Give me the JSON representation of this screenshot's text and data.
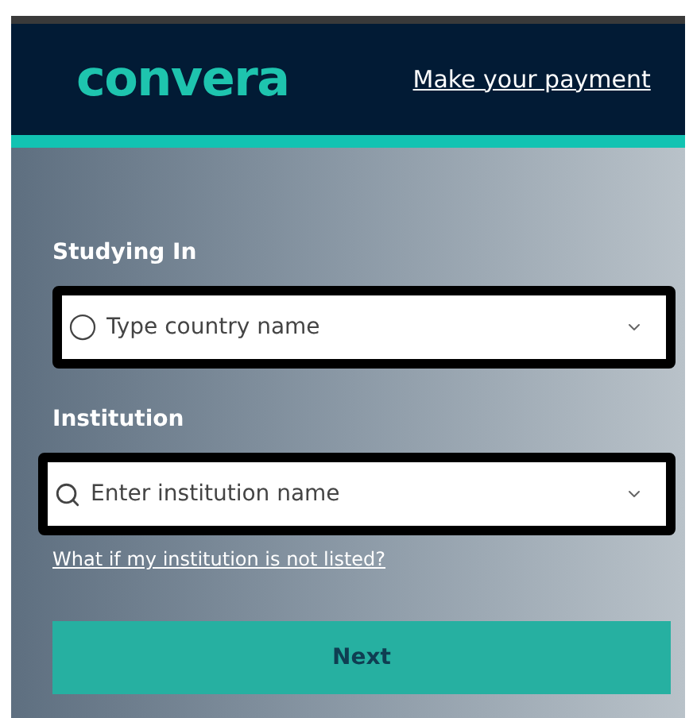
{
  "header": {
    "logo": "convera",
    "nav_link": "Make your payment"
  },
  "form": {
    "fields": [
      {
        "label": "Studying In",
        "placeholder": "Type country name",
        "kind": "country"
      },
      {
        "label": "Institution",
        "placeholder": "Enter institution name",
        "kind": "search"
      }
    ],
    "help_link": "What if my institution is not listed?",
    "button": "Next"
  }
}
